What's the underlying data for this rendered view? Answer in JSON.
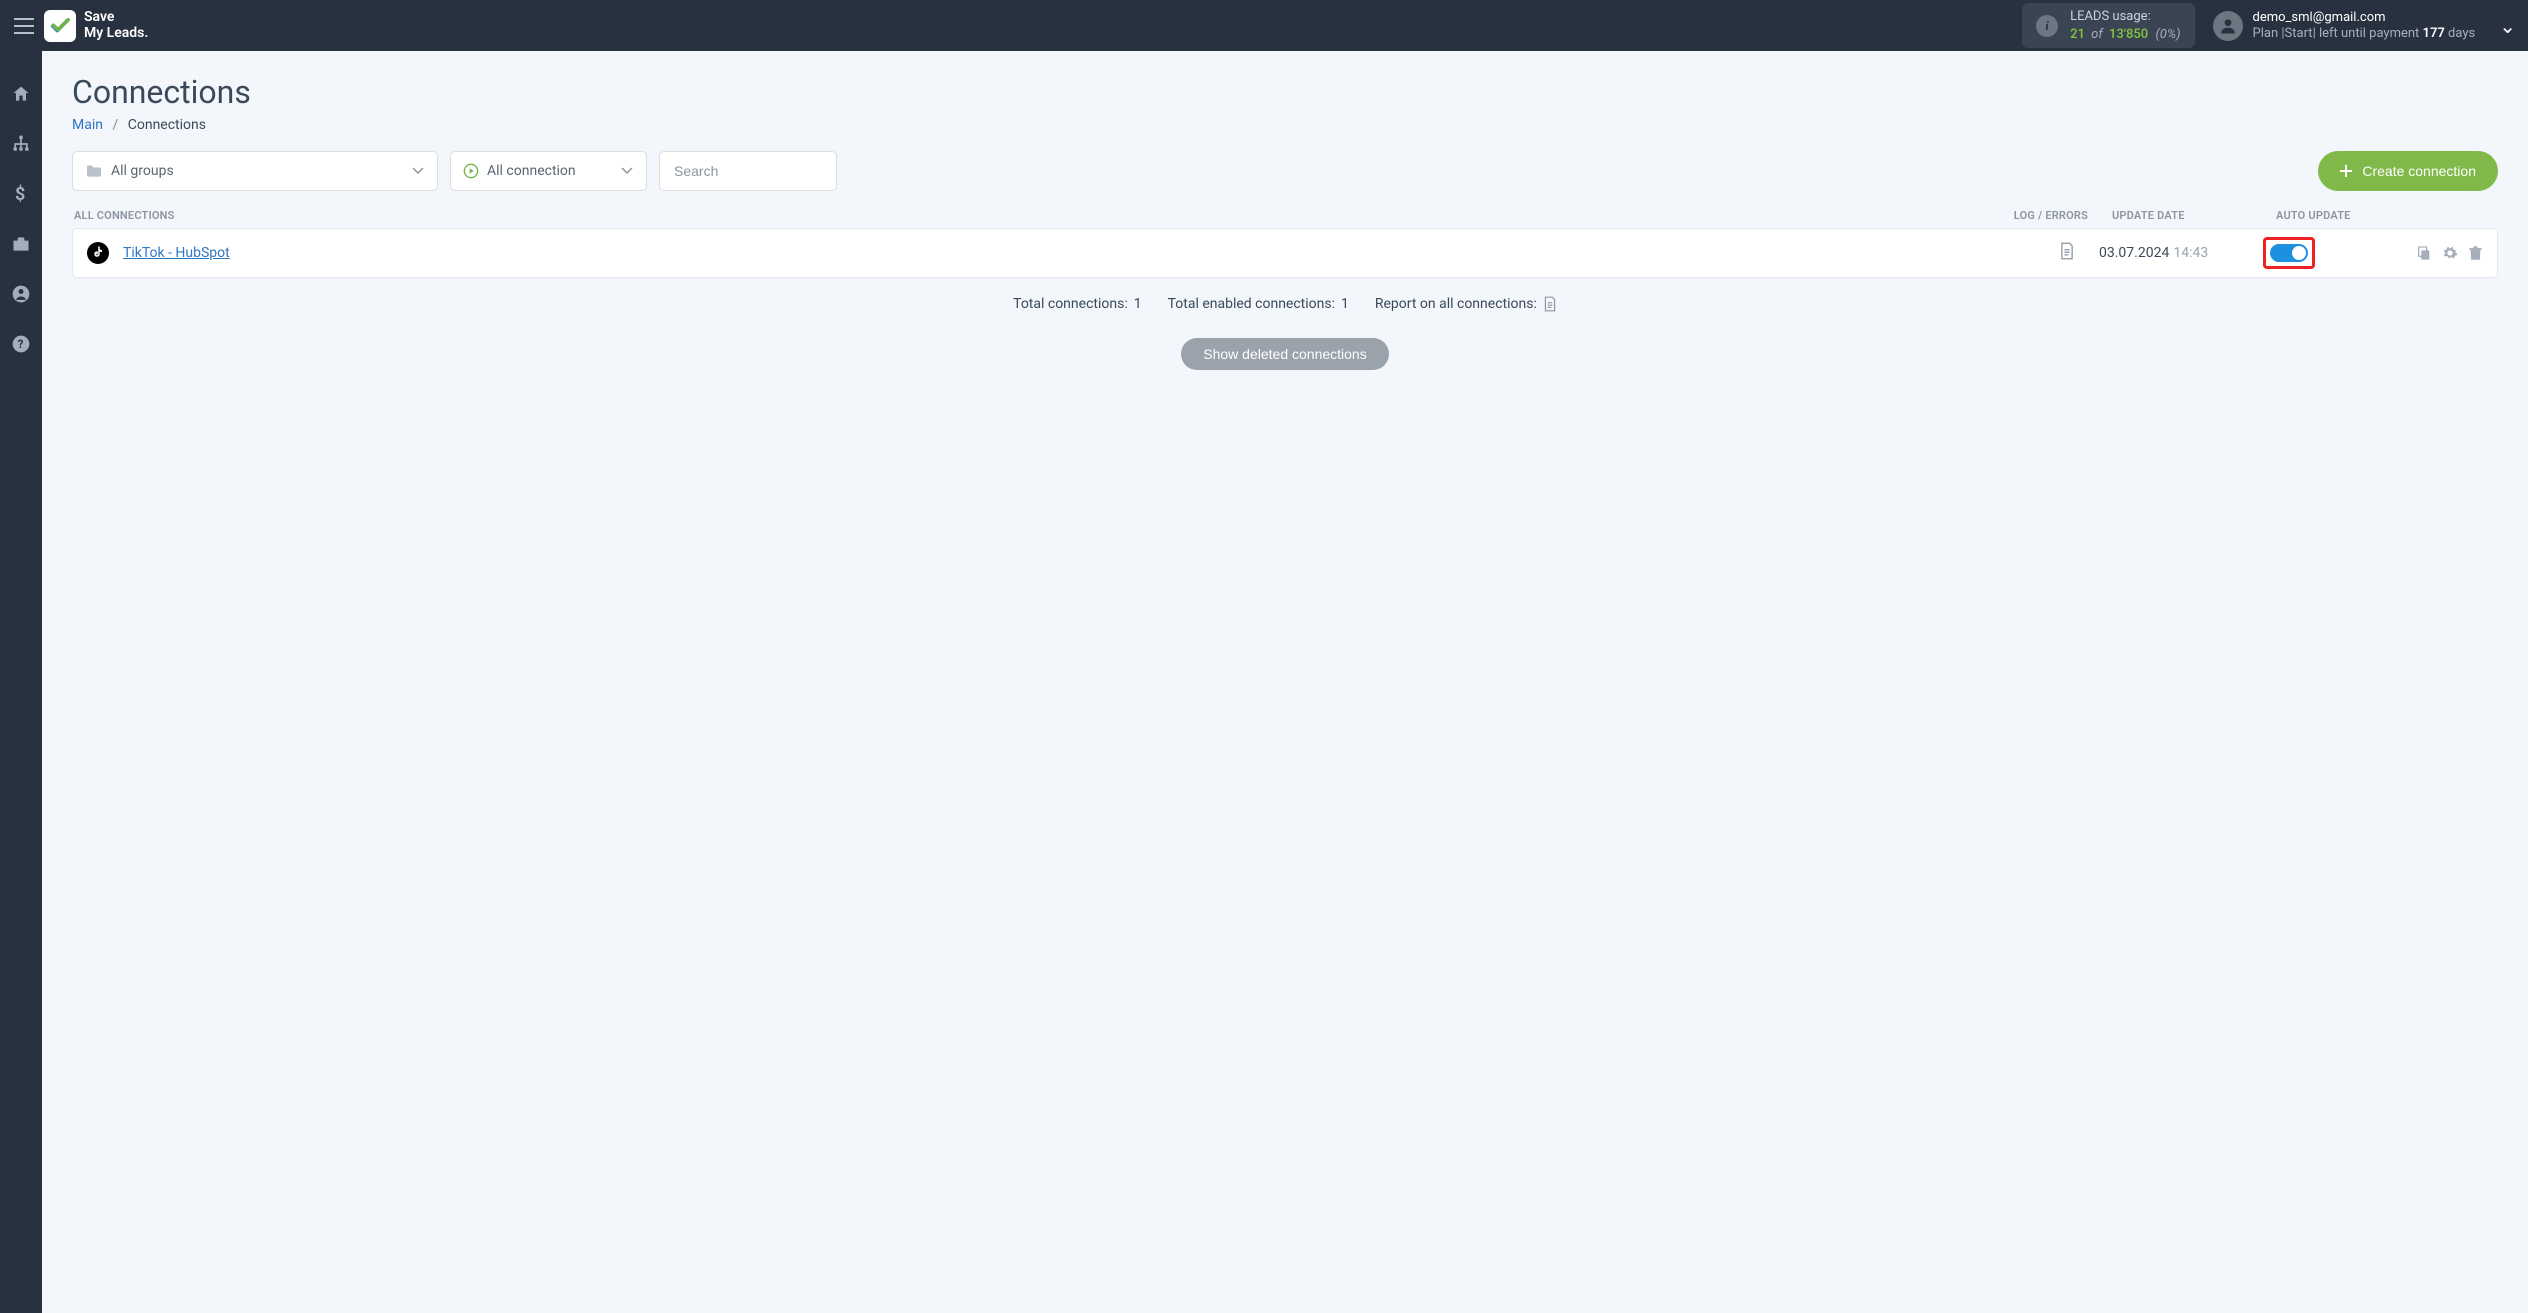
{
  "header": {
    "brand_line1": "Save",
    "brand_line2": "My Leads.",
    "leads": {
      "label": "LEADS usage:",
      "used": "21",
      "of": "of",
      "total": "13'850",
      "pct": "(0%)"
    },
    "user": {
      "email": "demo_sml@gmail.com",
      "plan_prefix": "Plan |",
      "plan_name": "Start",
      "plan_mid": "| left until payment ",
      "days": "177",
      "days_suffix": " days"
    }
  },
  "page": {
    "title": "Connections",
    "breadcrumb_main": "Main",
    "breadcrumb_current": "Connections"
  },
  "filters": {
    "groups_label": "All groups",
    "status_label": "All connection",
    "search_placeholder": "Search",
    "create_label": "Create connection"
  },
  "table": {
    "header_all": "ALL CONNECTIONS",
    "header_log": "LOG / ERRORS",
    "header_date": "UPDATE DATE",
    "header_auto": "AUTO UPDATE",
    "rows": [
      {
        "name": "TikTok - HubSpot",
        "date": "03.07.2024",
        "time": "14:43",
        "auto_update_on": true
      }
    ]
  },
  "summary": {
    "total_conns_label": "Total connections: ",
    "total_conns_value": "1",
    "enabled_label": "Total enabled connections: ",
    "enabled_value": "1",
    "report_label": "Report on all connections:"
  },
  "buttons": {
    "show_deleted": "Show deleted connections"
  }
}
